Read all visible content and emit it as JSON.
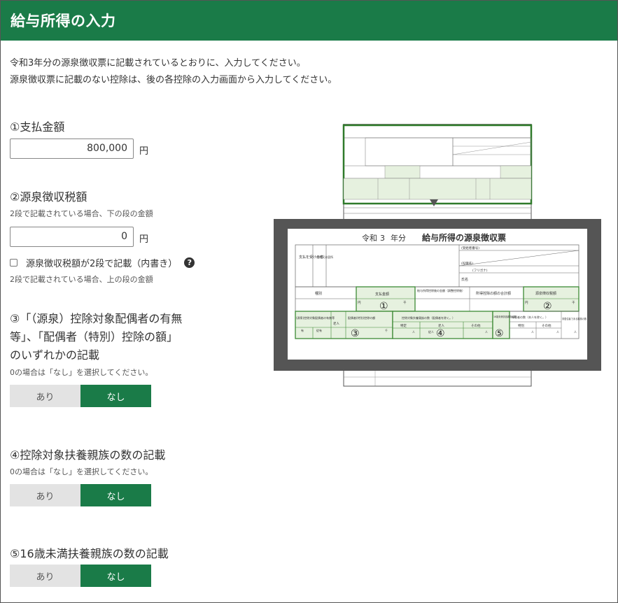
{
  "header": {
    "title": "給与所得の入力"
  },
  "intro": {
    "line1": "令和3年分の源泉徴収票に記載されているとおりに、入力してください。",
    "line2": "源泉徴収票に記載のない控除は、後の各控除の入力画面から入力してください。"
  },
  "payment": {
    "label": "①支払金額",
    "value": "800,000",
    "unit": "円"
  },
  "withholding": {
    "label": "②源泉徴収税額",
    "note_lower": "2段で記載されている場合、下の段の金額",
    "value": "0",
    "unit": "円",
    "check_label": "源泉徴収税額が2段で記載（内書き）",
    "help": "?",
    "note_upper": "2段で記載されている場合、上の段の金額"
  },
  "spouse": {
    "label_line1": "③「（源泉）控除対象配偶者の有無",
    "label_line2": "等」、「配偶者（特別）控除の額」",
    "label_line3": "のいずれかの記載",
    "note": "0の場合は「なし」を選択してください。",
    "yes": "あり",
    "no": "なし",
    "selected": "なし"
  },
  "dependents": {
    "label": "④控除対象扶養親族の数の記載",
    "note": "0の場合は「なし」を選択してください。",
    "yes": "あり",
    "no": "なし",
    "selected": "なし"
  },
  "under16": {
    "label": "⑤16歳未満扶養親族の数の記載",
    "yes": "あり",
    "no": "なし",
    "selected": "なし"
  },
  "slip": {
    "era": "令和",
    "year": "3",
    "year_suffix": "年分",
    "title": "給与所得の源泉徴収票",
    "payee_label": "支払を受ける者",
    "address_label": "住所又は居所",
    "recipient_no": "(受給者番号)",
    "position": "(役職名)",
    "furigana": "(フリガナ)",
    "name_label": "氏名",
    "col_type": "種別",
    "col_payment": "支払金額",
    "col_after_deduction": "給与所得控除後の金額（調整控除後）",
    "col_total_deduction": "所得控除の額の合計額",
    "col_tax": "源泉徴収税額",
    "yen": "円",
    "thousand": "千",
    "spouse_head": "(源泉)控除対象配偶者の有無等",
    "elderly": "老人",
    "have": "有",
    "from": "従有",
    "spouse_deduction": "配偶者(特別)控除の額",
    "dep_head": "控除対象扶養親族の数（配偶者を除く。）",
    "specific": "特定",
    "other": "その他",
    "person": "人",
    "from_person": "従人",
    "under16_head": "16歳未満扶養親族の数",
    "disabled_head": "障害者の数（本人を除く。）",
    "special": "特別",
    "non_resident": "非居住者である親族の数",
    "m1": "①",
    "m2": "②",
    "m3": "③",
    "m4": "④",
    "m5": "⑤"
  },
  "colors": {
    "brand": "#1a7b48",
    "highlight": "#e6f1df",
    "highlight_border": "#3d8a35"
  }
}
